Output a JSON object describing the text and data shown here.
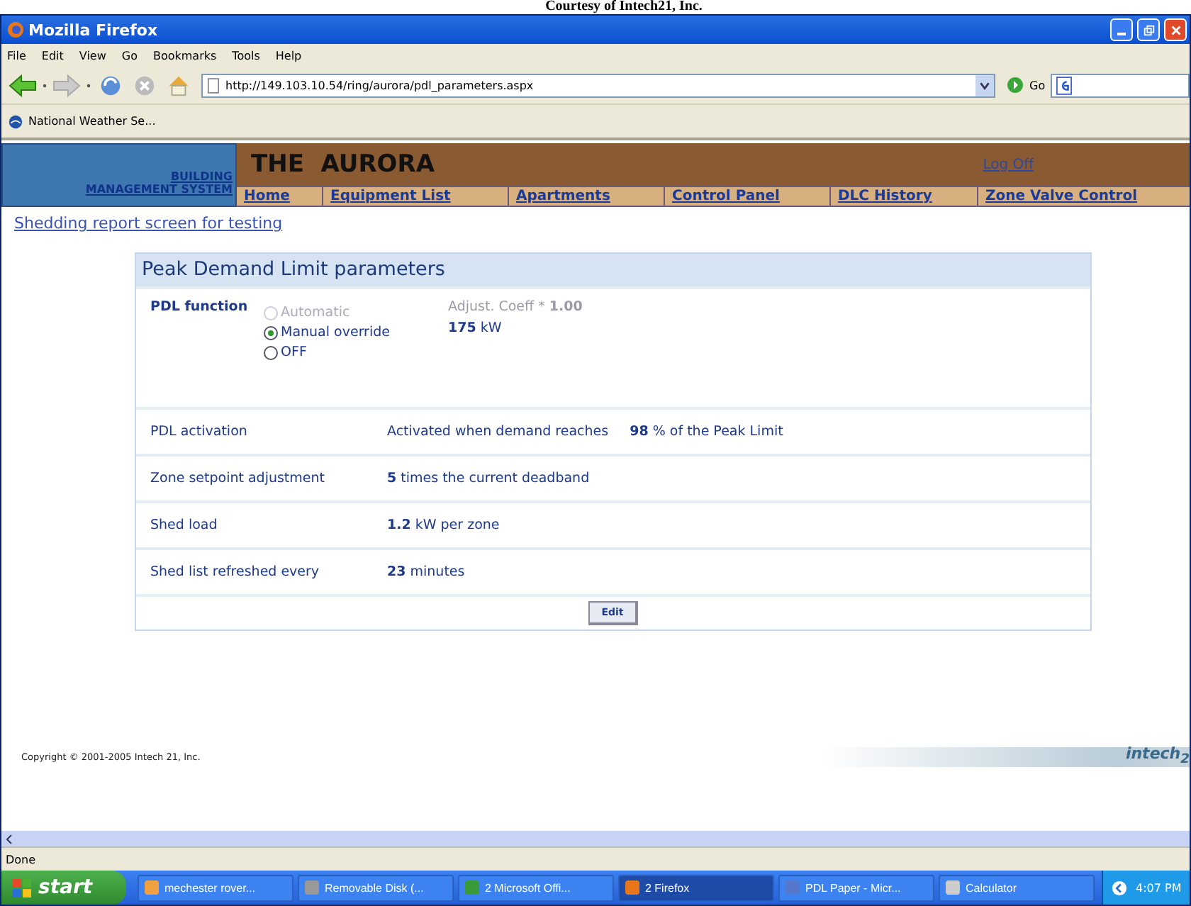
{
  "caption": "Courtesy of Intech21, Inc.",
  "window": {
    "title": "Mozilla Firefox"
  },
  "menu": [
    "File",
    "Edit",
    "View",
    "Go",
    "Bookmarks",
    "Tools",
    "Help"
  ],
  "toolbar": {
    "address": "http://149.103.10.54/ring/aurora/pdl_parameters.aspx",
    "go": "Go"
  },
  "bookmarks": [
    "National Weather Se..."
  ],
  "site": {
    "brand_lines": [
      "BUILDING",
      "MANAGEMENT SYSTEM"
    ],
    "title": "THE  AURORA",
    "logoff": "Log Off",
    "nav": [
      "Home",
      "Equipment List",
      "Apartments",
      "Control Panel",
      "DLC History",
      "Zone Valve Control"
    ]
  },
  "report_link": "Shedding report screen for testing",
  "panel": {
    "title": "Peak Demand Limit parameters",
    "pdl_function": {
      "label": "PDL function",
      "options": [
        {
          "label": "Automatic",
          "selected": false,
          "disabled": true
        },
        {
          "label": "Manual override",
          "selected": true,
          "disabled": false
        },
        {
          "label": "OFF",
          "selected": false,
          "disabled": false
        }
      ],
      "adjust": "Adjust. Coeff * **1.00**",
      "power": "**175** kW"
    },
    "rows": [
      {
        "label": "PDL activation",
        "cells": [
          "Activated when demand reaches",
          "**98** % of the Peak Limit"
        ]
      },
      {
        "label": "Zone setpoint adjustment",
        "cells": [
          "**5** times the current deadband"
        ]
      },
      {
        "label": "Shed load",
        "cells": [
          "**1.2** kW per zone"
        ]
      },
      {
        "label": "Shed list refreshed every",
        "cells": [
          "**23** minutes"
        ]
      }
    ],
    "button": "Edit"
  },
  "footer": {
    "copyright": "Copyright © 2001-2005 Intech 21, Inc.",
    "logo": "intech$_{2}$"
  },
  "status": "Done",
  "taskbar": {
    "start": "start",
    "tasks": [
      {
        "label": "mechester rover...",
        "selected": false
      },
      {
        "label": "Removable Disk (...",
        "selected": false
      },
      {
        "label": "2 Microsoft Offi...",
        "selected": false
      },
      {
        "label": "2 Firefox",
        "selected": true
      },
      {
        "label": "PDL Paper - Micr...",
        "selected": false
      },
      {
        "label": "Calculator",
        "selected": false
      }
    ],
    "clock": "4:07 PM"
  }
}
